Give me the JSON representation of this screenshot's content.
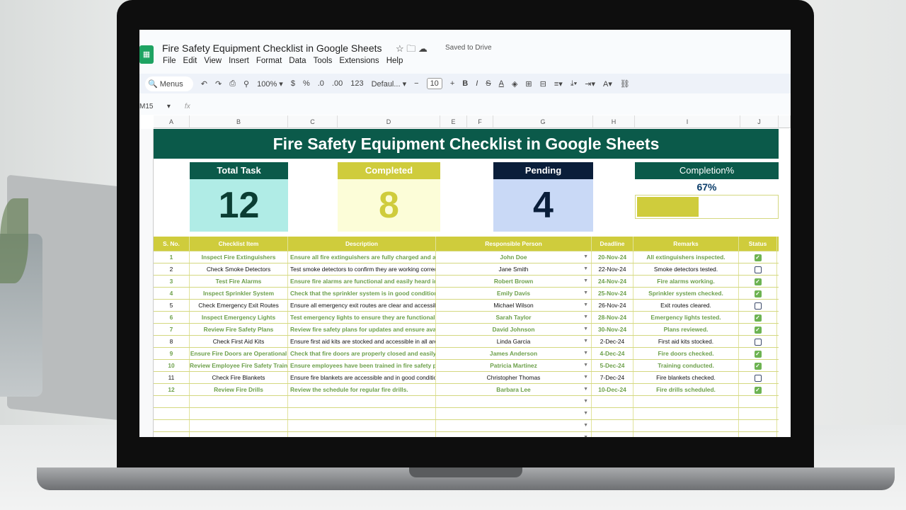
{
  "app": {
    "title": "Fire Safety Equipment Checklist in Google Sheets",
    "saved": "Saved to Drive",
    "menus": [
      "File",
      "Edit",
      "View",
      "Insert",
      "Format",
      "Data",
      "Tools",
      "Extensions",
      "Help"
    ]
  },
  "toolbar": {
    "search": "Menus",
    "zoom": "100%",
    "currency": "$",
    "percent": "%",
    "dec_less": ".0",
    "dec_more": ".00",
    "number_format": "123",
    "font": "Defaul...",
    "font_size": "10"
  },
  "formula_bar": {
    "cell_ref": "M15",
    "fx": "fx"
  },
  "columns": [
    "A",
    "B",
    "C",
    "D",
    "E",
    "F",
    "G",
    "H",
    "I",
    "J"
  ],
  "sheet_title": "Fire Safety Equipment Checklist in Google Sheets",
  "cards": {
    "total": {
      "label": "Total Task",
      "value": "12"
    },
    "completed": {
      "label": "Completed",
      "value": "8"
    },
    "pending": {
      "label": "Pending",
      "value": "4"
    },
    "completion": {
      "label": "Completion%",
      "value": "67%",
      "fraction": 0.67
    }
  },
  "colors": {
    "band": "#0b5a4a",
    "accent": "#cfcc3c",
    "done_text": "#6da04b"
  },
  "table": {
    "headers": [
      "S. No.",
      "Checklist Item",
      "Description",
      "Responsible Person",
      "Deadline",
      "Remarks",
      "Status"
    ],
    "rows": [
      {
        "no": "1",
        "item": "Inspect Fire Extinguishers",
        "desc": "Ensure all fire extinguishers are fully charged and acc",
        "person": "John Doe",
        "deadline": "20-Nov-24",
        "remarks": "All extinguishers inspected.",
        "done": true
      },
      {
        "no": "2",
        "item": "Check Smoke Detectors",
        "desc": "Test smoke detectors to confirm they are working correctly",
        "person": "Jane Smith",
        "deadline": "22-Nov-24",
        "remarks": "Smoke detectors tested.",
        "done": false
      },
      {
        "no": "3",
        "item": "Test Fire Alarms",
        "desc": "Ensure fire alarms are functional and easily heard in a",
        "person": "Robert Brown",
        "deadline": "24-Nov-24",
        "remarks": "Fire alarms working.",
        "done": true
      },
      {
        "no": "4",
        "item": "Inspect Sprinkler System",
        "desc": "Check that the sprinkler system is in good condition a",
        "person": "Emily Davis",
        "deadline": "25-Nov-24",
        "remarks": "Sprinkler system checked.",
        "done": true
      },
      {
        "no": "5",
        "item": "Check Emergency Exit Routes",
        "desc": "Ensure all emergency exit routes are clear and accessible.",
        "person": "Michael Wilson",
        "deadline": "26-Nov-24",
        "remarks": "Exit routes cleared.",
        "done": false
      },
      {
        "no": "6",
        "item": "Inspect Emergency Lights",
        "desc": "Test emergency lights to ensure they are functional du",
        "person": "Sarah Taylor",
        "deadline": "28-Nov-24",
        "remarks": "Emergency lights tested.",
        "done": true
      },
      {
        "no": "7",
        "item": "Review Fire Safety Plans",
        "desc": "Review fire safety plans for updates and ensure availa",
        "person": "David Johnson",
        "deadline": "30-Nov-24",
        "remarks": "Plans reviewed.",
        "done": true
      },
      {
        "no": "8",
        "item": "Check First Aid Kits",
        "desc": "Ensure first aid kits are stocked and accessible in all areas",
        "person": "Linda Garcia",
        "deadline": "2-Dec-24",
        "remarks": "First aid kits stocked.",
        "done": false
      },
      {
        "no": "9",
        "item": "Ensure Fire Doors are Operational",
        "desc": "Check that fire doors are properly closed and easily op",
        "person": "James Anderson",
        "deadline": "4-Dec-24",
        "remarks": "Fire doors checked.",
        "done": true
      },
      {
        "no": "10",
        "item": "Review Employee Fire Safety Training",
        "desc": "Ensure employees have been trained in fire safety pro",
        "person": "Patricia Martinez",
        "deadline": "5-Dec-24",
        "remarks": "Training conducted.",
        "done": true
      },
      {
        "no": "11",
        "item": "Check Fire Blankets",
        "desc": "Ensure fire blankets are accessible and in good condition.",
        "person": "Christopher Thomas",
        "deadline": "7-Dec-24",
        "remarks": "Fire blankets checked.",
        "done": false
      },
      {
        "no": "12",
        "item": "Review Fire Drills",
        "desc": "Review the schedule for regular fire drills.",
        "person": "Barbara Lee",
        "deadline": "10-Dec-24",
        "remarks": "Fire drills scheduled.",
        "done": true
      }
    ]
  }
}
